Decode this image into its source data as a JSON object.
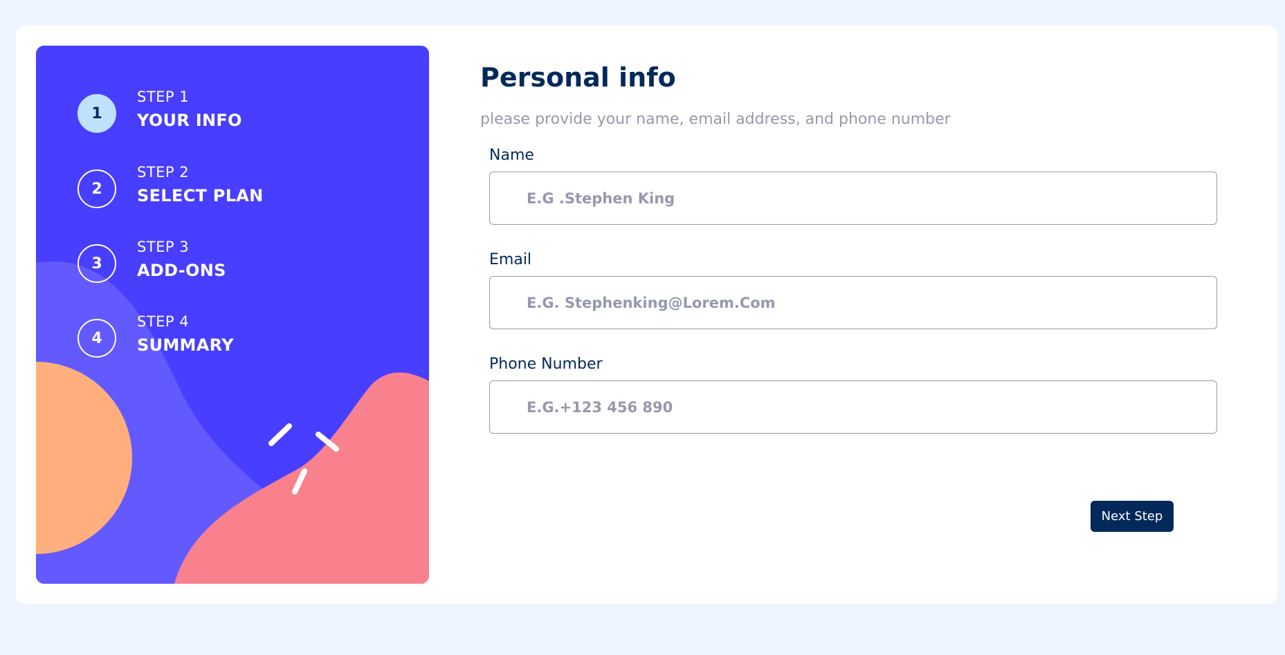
{
  "colors": {
    "page_background": "#eef5ff",
    "sidebar_blue": "#483eff",
    "sidebar_wave_lavender": "#6259ff",
    "sidebar_circle_orange": "#ffaf7e",
    "sidebar_wave_pink": "#f9818e",
    "active_step_fill": "#bfe2fd",
    "marine_blue": "#02295a",
    "cool_gray": "#9699ab"
  },
  "sidebar": {
    "steps": [
      {
        "number": "1",
        "kicker": "STEP 1",
        "title": "YOUR INFO",
        "active": true
      },
      {
        "number": "2",
        "kicker": "STEP 2",
        "title": "SELECT PLAN",
        "active": false
      },
      {
        "number": "3",
        "kicker": "STEP 3",
        "title": "ADD-ONS",
        "active": false
      },
      {
        "number": "4",
        "kicker": "STEP 4",
        "title": "SUMMARY",
        "active": false
      }
    ]
  },
  "main": {
    "title": "Personal info",
    "subtitle": "please provide your name, email address, and phone number",
    "fields": [
      {
        "label": "Name",
        "value": "",
        "placeholder": "E.G .Stephen King"
      },
      {
        "label": "Email",
        "value": "",
        "placeholder": "E.G. Stephenking@Lorem.Com"
      },
      {
        "label": "Phone Number",
        "value": "",
        "placeholder": "E.G.+123 456 890"
      }
    ],
    "next_button_label": "Next Step"
  }
}
